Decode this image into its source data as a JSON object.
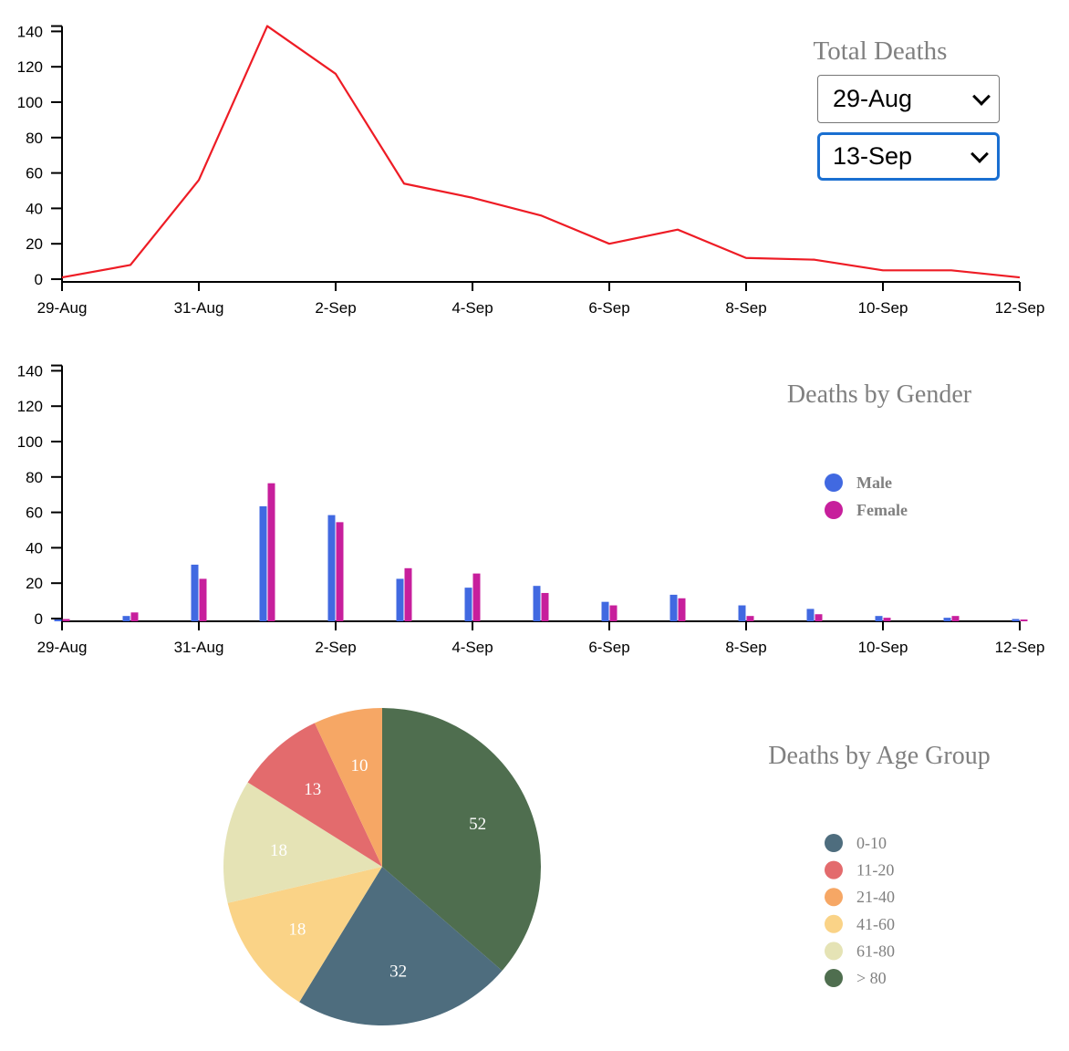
{
  "controls": {
    "title": "Total Deaths",
    "start_date": "29-Aug",
    "end_date": "13-Sep"
  },
  "chart_data": [
    {
      "type": "line",
      "title": "Total Deaths",
      "x": [
        "29-Aug",
        "30-Aug",
        "31-Aug",
        "1-Sep",
        "2-Sep",
        "3-Sep",
        "4-Sep",
        "5-Sep",
        "6-Sep",
        "7-Sep",
        "8-Sep",
        "9-Sep",
        "10-Sep",
        "11-Sep",
        "12-Sep"
      ],
      "x_ticks": [
        "29-Aug",
        "31-Aug",
        "2-Sep",
        "4-Sep",
        "6-Sep",
        "8-Sep",
        "10-Sep",
        "12-Sep"
      ],
      "series": [
        {
          "values": [
            1,
            8,
            56,
            143,
            116,
            54,
            46,
            36,
            20,
            28,
            12,
            11,
            5,
            5,
            1
          ],
          "color": "#ee1c25"
        }
      ],
      "y_ticks": [
        0,
        20,
        40,
        60,
        80,
        100,
        120,
        140
      ],
      "ylim": [
        0,
        143
      ],
      "grid": false
    },
    {
      "type": "bar",
      "title": "Deaths by Gender",
      "x": [
        "29-Aug",
        "30-Aug",
        "31-Aug",
        "1-Sep",
        "2-Sep",
        "3-Sep",
        "4-Sep",
        "5-Sep",
        "6-Sep",
        "7-Sep",
        "8-Sep",
        "9-Sep",
        "10-Sep",
        "11-Sep",
        "12-Sep"
      ],
      "x_ticks": [
        "29-Aug",
        "31-Aug",
        "2-Sep",
        "4-Sep",
        "6-Sep",
        "8-Sep",
        "10-Sep",
        "12-Sep"
      ],
      "series": [
        {
          "name": "Male",
          "color": "#4169e1",
          "values": [
            1,
            3,
            32,
            65,
            60,
            24,
            19,
            20,
            11,
            15,
            9,
            7,
            3,
            2,
            0
          ]
        },
        {
          "name": "Female",
          "color": "#c71f9c",
          "values": [
            0,
            5,
            24,
            78,
            56,
            30,
            27,
            16,
            9,
            13,
            3,
            4,
            2,
            3,
            1
          ]
        }
      ],
      "y_ticks": [
        0,
        20,
        40,
        60,
        80,
        100,
        120,
        140
      ],
      "ylim": [
        0,
        143
      ],
      "legend": "right",
      "grid": false
    },
    {
      "type": "pie",
      "title": "Deaths by Age Group",
      "slices": [
        {
          "label": "> 80",
          "value": 52,
          "color": "#4f6e4f"
        },
        {
          "label": "0-10",
          "value": 32,
          "color": "#4e6d7e"
        },
        {
          "label": "41-60",
          "value": 18,
          "color": "#fad387"
        },
        {
          "label": "61-80",
          "value": 18,
          "color": "#e5e3b5"
        },
        {
          "label": "11-20",
          "value": 13,
          "color": "#e36b6d"
        },
        {
          "label": "21-40",
          "value": 10,
          "color": "#f6a765"
        }
      ],
      "legend_order": [
        "0-10",
        "11-20",
        "21-40",
        "41-60",
        "61-80",
        "> 80"
      ],
      "legend": "right"
    }
  ]
}
